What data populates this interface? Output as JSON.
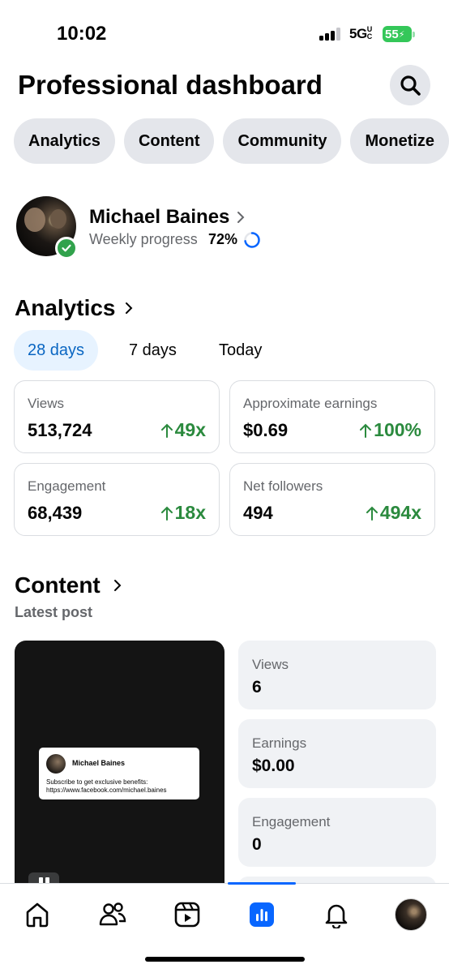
{
  "status_bar": {
    "time": "10:02",
    "network": "5G",
    "network_suffix": "UC",
    "battery": "55"
  },
  "header": {
    "title": "Professional dashboard"
  },
  "chips": [
    "Analytics",
    "Content",
    "Community",
    "Monetize"
  ],
  "profile": {
    "name": "Michael Baines",
    "progress_label": "Weekly progress",
    "progress_value": "72%",
    "progress_fraction": 0.72
  },
  "analytics": {
    "title": "Analytics",
    "ranges": [
      "28 days",
      "7 days",
      "Today"
    ],
    "selected_range": "28 days",
    "metrics": [
      {
        "label": "Views",
        "value": "513,724",
        "change": "49x"
      },
      {
        "label": "Approximate earnings",
        "value": "$0.69",
        "change": "100%"
      },
      {
        "label": "Engagement",
        "value": "68,439",
        "change": "18x"
      },
      {
        "label": "Net followers",
        "value": "494",
        "change": "494x"
      }
    ]
  },
  "content": {
    "title": "Content",
    "subtitle": "Latest post",
    "post": {
      "author": "Michael Baines",
      "text": "Subscribe to get exclusive benefits: https://www.facebook.com/michael.baines"
    },
    "stats": [
      {
        "label": "Views",
        "value": "6"
      },
      {
        "label": "Earnings",
        "value": "$0.00"
      },
      {
        "label": "Engagement",
        "value": "0"
      }
    ]
  },
  "colors": {
    "accent": "#0866ff",
    "positive": "#2b8a3e",
    "chip_bg": "#e4e6eb",
    "battery": "#34c759"
  },
  "bottom_nav": [
    "home-icon",
    "friends-icon",
    "reels-icon",
    "dashboard-icon",
    "notifications-icon",
    "profile-avatar"
  ]
}
